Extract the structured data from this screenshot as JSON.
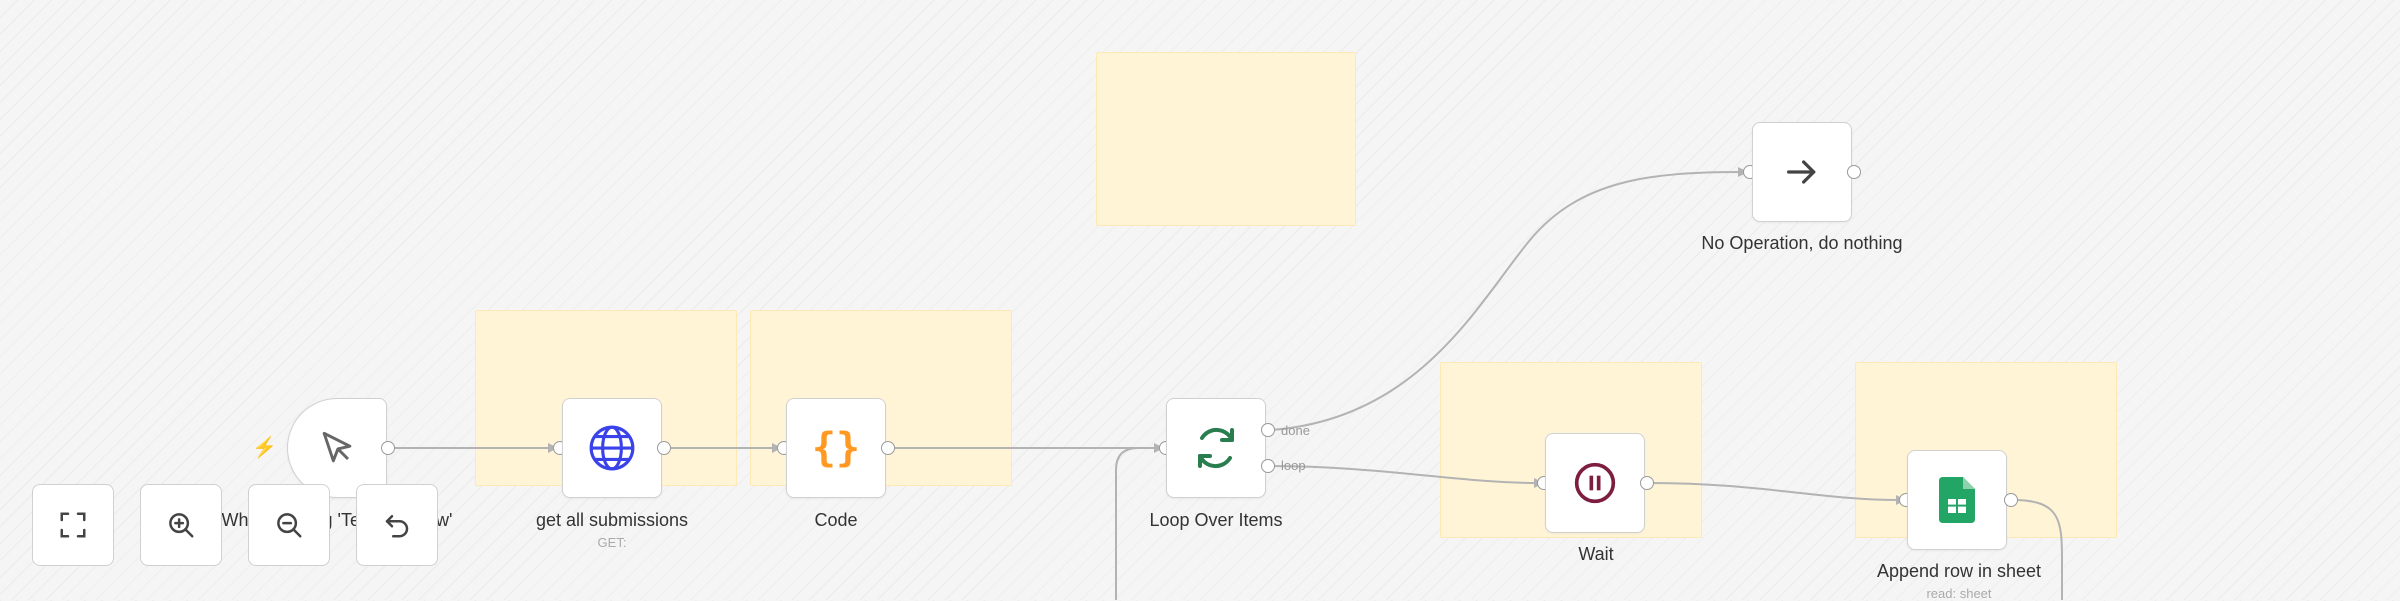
{
  "nodes": {
    "trigger": {
      "label": "When clicking 'Test workflow'",
      "icon": "cursor-pointer-icon"
    },
    "http": {
      "label": "get all submissions",
      "sub": "GET:",
      "icon": "globe-icon"
    },
    "code": {
      "label": "Code",
      "icon": "code-braces-icon"
    },
    "loop": {
      "label": "Loop Over Items",
      "ports": {
        "done": "done",
        "loop": "loop"
      },
      "icon": "refresh-icon"
    },
    "noop": {
      "label": "No Operation, do nothing",
      "icon": "arrow-right-icon"
    },
    "wait": {
      "label": "Wait",
      "icon": "pause-icon"
    },
    "sheets": {
      "label": "Append row in sheet",
      "sub": "read: sheet",
      "icon": "google-sheets-icon"
    }
  },
  "controls": {
    "fit_view": "fullscreen-icon",
    "zoom_in": "zoom-in-icon",
    "zoom_out": "zoom-out-icon",
    "undo": "undo-icon"
  },
  "colors": {
    "sticky": "#fff5d6",
    "accent": "#ff6d5a",
    "http_icon": "#3a42e9",
    "code_icon": "#ff9922",
    "loop_icon": "#2a7d4f",
    "wait_icon": "#7d1d3f",
    "sheets_icon": "#23a566"
  }
}
